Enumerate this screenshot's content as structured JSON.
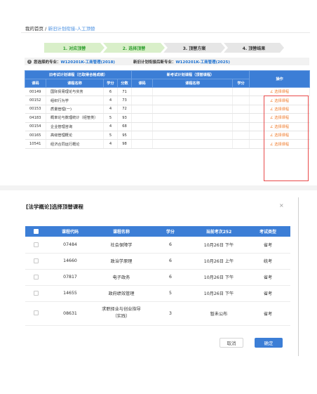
{
  "breadcrumb": {
    "home": "我的首页",
    "separator": " / ",
    "current": "新旧计划衔接-人工顶替"
  },
  "steps": [
    {
      "label": "1. 对应顶替",
      "state": "done"
    },
    {
      "label": "2. 选择顶替",
      "state": "done"
    },
    {
      "label": "3. 顶替方案",
      "state": "todo"
    },
    {
      "label": "4. 顶替结果",
      "state": "todo"
    }
  ],
  "info": {
    "selected_label": "您选择的专业：",
    "selected_value": "W120201K-工商管理(2018)",
    "new_label": "新旧计划衔接后新专业：",
    "new_value": "W120201K-工商管理(2025)"
  },
  "main_table": {
    "group_old": "旧考试计划课程（已取得合格成绩）",
    "group_new": "新考试计划课程（顶替课程）",
    "group_op": "操作",
    "headers": [
      "课码",
      "课程名称",
      "学分",
      "分数",
      "课码",
      "课程名称",
      "学分"
    ],
    "rows": [
      {
        "code": "00149",
        "name": "国际贸易理论与实务",
        "credit": "6",
        "score": "71",
        "action": "∠ 选择课程"
      },
      {
        "code": "00152",
        "name": "组织行为学",
        "credit": "4",
        "score": "73",
        "action": "∠ 选择课程"
      },
      {
        "code": "00153",
        "name": "质量管理(一)",
        "credit": "4",
        "score": "72",
        "action": "∠ 选择课程"
      },
      {
        "code": "04183",
        "name": "概率论与数理统计（经管类）",
        "credit": "5",
        "score": "93",
        "action": "∠ 选择课程"
      },
      {
        "code": "00154",
        "name": "企业管理咨询",
        "credit": "4",
        "score": "68",
        "action": "∠ 选择课程"
      },
      {
        "code": "00165",
        "name": "高级管理概论",
        "credit": "5",
        "score": "95",
        "action": "∠ 选择课程"
      },
      {
        "code": "10541",
        "name": "经济合同运行概论",
        "credit": "4",
        "score": "98",
        "action": "∠ 选择课程"
      }
    ]
  },
  "modal": {
    "title": "[法学概论]选择顶替课程",
    "close": "×",
    "headers": [
      "课程代码",
      "课程名称",
      "学分",
      "当前考次252",
      "考试类型"
    ],
    "rows": [
      {
        "code": "07484",
        "name": "社会保障学",
        "credit": "6",
        "slot": "10月26日 下午",
        "type": "省考"
      },
      {
        "code": "14660",
        "name": "政治学原理",
        "credit": "6",
        "slot": "10月26日 上午",
        "type": "统考"
      },
      {
        "code": "07817",
        "name": "电子政务",
        "credit": "6",
        "slot": "10月26日 下午",
        "type": "省考"
      },
      {
        "code": "14655",
        "name": "政府绩效管理",
        "credit": "5",
        "slot": "10月26日 下午",
        "type": "省考"
      },
      {
        "code": "08631",
        "name": "求职择业与创业指导（实践）",
        "credit": "3",
        "slot": "暂未公布",
        "type": "省考"
      }
    ],
    "cancel": "取消",
    "confirm": "确定"
  }
}
